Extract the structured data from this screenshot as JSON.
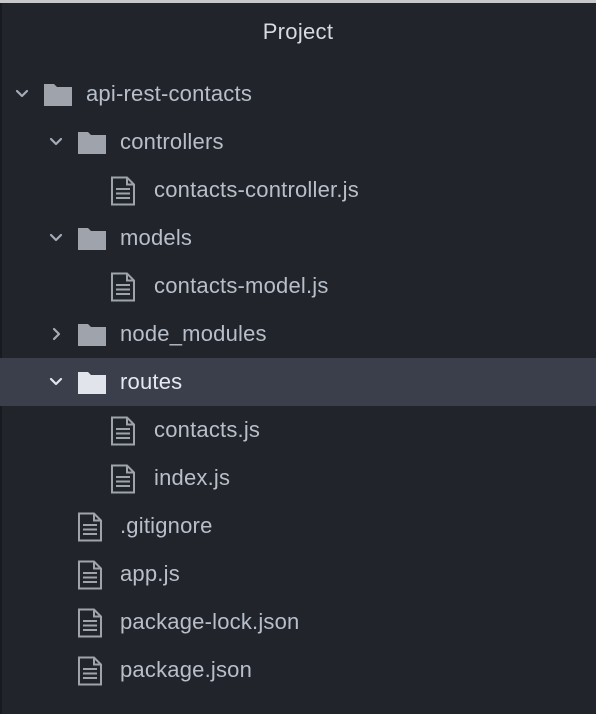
{
  "panel": {
    "title": "Project"
  },
  "tree": {
    "root": {
      "label": "api-rest-contacts",
      "expanded": true,
      "icon": "folder-icon"
    },
    "controllers": {
      "label": "controllers",
      "expanded": true,
      "icon": "folder-icon"
    },
    "contacts_controller": {
      "label": "contacts-controller.js",
      "icon": "file-text-icon"
    },
    "models": {
      "label": "models",
      "expanded": true,
      "icon": "folder-icon"
    },
    "contacts_model": {
      "label": "contacts-model.js",
      "icon": "file-text-icon"
    },
    "node_modules": {
      "label": "node_modules",
      "expanded": false,
      "icon": "folder-icon"
    },
    "routes": {
      "label": "routes",
      "expanded": true,
      "selected": true,
      "icon": "folder-icon"
    },
    "contacts_js": {
      "label": "contacts.js",
      "icon": "file-text-icon"
    },
    "index_js": {
      "label": "index.js",
      "icon": "file-text-icon"
    },
    "gitignore": {
      "label": ".gitignore",
      "icon": "file-text-icon"
    },
    "app_js": {
      "label": "app.js",
      "icon": "file-text-icon"
    },
    "package_lock": {
      "label": "package-lock.json",
      "icon": "file-text-icon"
    },
    "package_json": {
      "label": "package.json",
      "icon": "file-text-icon"
    }
  },
  "colors": {
    "background": "#21252b",
    "selection": "#3a3f4b",
    "text": "#b8bfca",
    "folder_icon": "#9fa3ab",
    "folder_icon_selected": "#e1e4ea"
  }
}
